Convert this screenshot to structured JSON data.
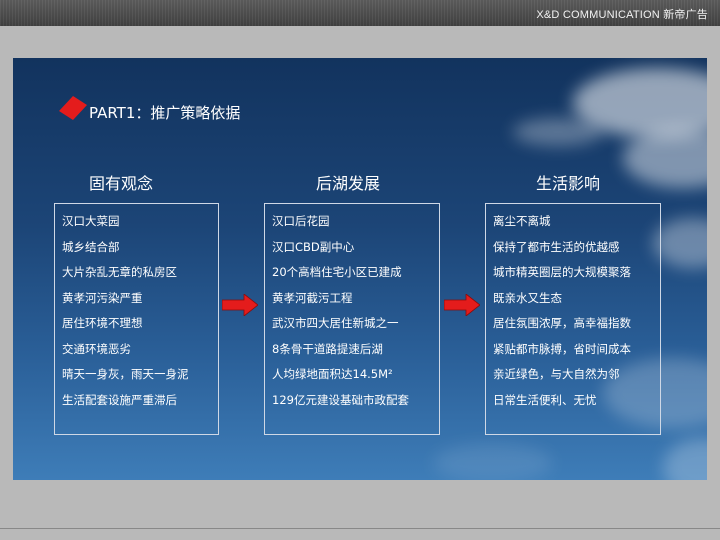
{
  "header": {
    "brand": "X&D COMMUNICATION 新帝广告"
  },
  "slide": {
    "title": "PART1：推广策略依据",
    "columns": [
      {
        "heading": "固有观念",
        "items": [
          "汉口大菜园",
          "城乡结合部",
          "大片杂乱无章的私房区",
          "黄孝河污染严重",
          "居住环境不理想",
          "交通环境恶劣",
          "晴天一身灰，雨天一身泥",
          "生活配套设施严重滞后"
        ]
      },
      {
        "heading": "后湖发展",
        "items": [
          "汉口后花园",
          "汉口CBD副中心",
          "20个高档住宅小区已建成",
          "黄孝河截污工程",
          "武汉市四大居住新城之一",
          "8条骨干道路提速后湖",
          "人均绿地面积达14.5M²",
          "129亿元建设基础市政配套"
        ]
      },
      {
        "heading": "生活影响",
        "items": [
          "离尘不离城",
          "保持了都市生活的优越感",
          "城市精英圈层的大规模聚落",
          "既亲水又生态",
          "居住氛围浓厚，高幸福指数",
          "紧贴都市脉搏，省时间成本",
          "亲近绿色，与大自然为邻",
          "日常生活便利、无忧"
        ]
      }
    ]
  },
  "colors": {
    "accent": "#e41c1c",
    "panel": "#1c4577",
    "text": "#ffffff"
  },
  "icons": [
    "red-diamond-icon",
    "right-arrow-icon"
  ]
}
